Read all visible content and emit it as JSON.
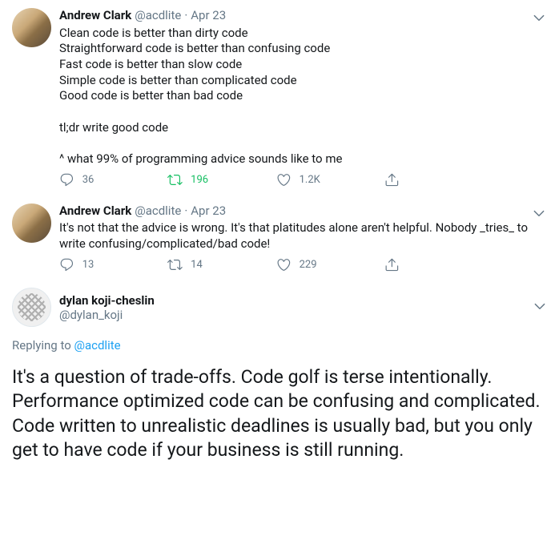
{
  "tweets": [
    {
      "display_name": "Andrew Clark",
      "handle": "@acdlite",
      "timestamp": "Apr 23",
      "body": "Clean code is better than dirty code\nStraightforward code is better than confusing code\nFast code is better than slow code\nSimple code is better than complicated code\nGood code is better than bad code\n\ntl;dr write good code\n\n^ what 99% of programming advice sounds like to me",
      "replies": "36",
      "retweets": "196",
      "likes": "1.2K",
      "retweeted": true
    },
    {
      "display_name": "Andrew Clark",
      "handle": "@acdlite",
      "timestamp": "Apr 23",
      "body": "It's not that the advice is wrong. It's that platitudes alone aren't helpful. Nobody _tries_ to write confusing/complicated/bad code!",
      "replies": "13",
      "retweets": "14",
      "likes": "229",
      "retweeted": false
    }
  ],
  "main": {
    "display_name": "dylan koji-cheslin",
    "handle": "@dylan_koji",
    "replying_label": "Replying to ",
    "replying_to": "@acdlite",
    "body": "It's a question of trade-offs. Code golf is terse intentionally. Performance optimized code can be confusing and complicated. Code written to unrealistic deadlines is usually bad, but you only get to have code if your business is still running."
  }
}
